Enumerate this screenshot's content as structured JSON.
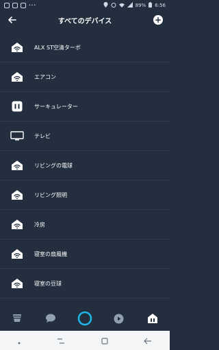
{
  "status": {
    "signal_label": "89%",
    "time": "6:56"
  },
  "header": {
    "title": "すべてのデバイス"
  },
  "devices": [
    {
      "label": "ALX ST空清ターボ",
      "icon": "wifi-home-icon"
    },
    {
      "label": "エアコン",
      "icon": "wifi-home-icon"
    },
    {
      "label": "サーキュレーター",
      "icon": "plug-icon"
    },
    {
      "label": "テレビ",
      "icon": "tv-icon"
    },
    {
      "label": "リビングの電球",
      "icon": "wifi-home-icon"
    },
    {
      "label": "リビング照明",
      "icon": "wifi-home-icon"
    },
    {
      "label": "冷房",
      "icon": "wifi-home-icon"
    },
    {
      "label": "寝室の扇風機",
      "icon": "wifi-home-icon"
    },
    {
      "label": "寝室の豆球",
      "icon": "wifi-home-icon"
    }
  ],
  "bottom_nav": [
    "home-icon",
    "chat-icon",
    "alexa-icon",
    "play-icon",
    "devices-icon"
  ],
  "colors": {
    "background": "#232f3e",
    "accent": "#1fb6e8",
    "divider": "#2f3e52"
  }
}
